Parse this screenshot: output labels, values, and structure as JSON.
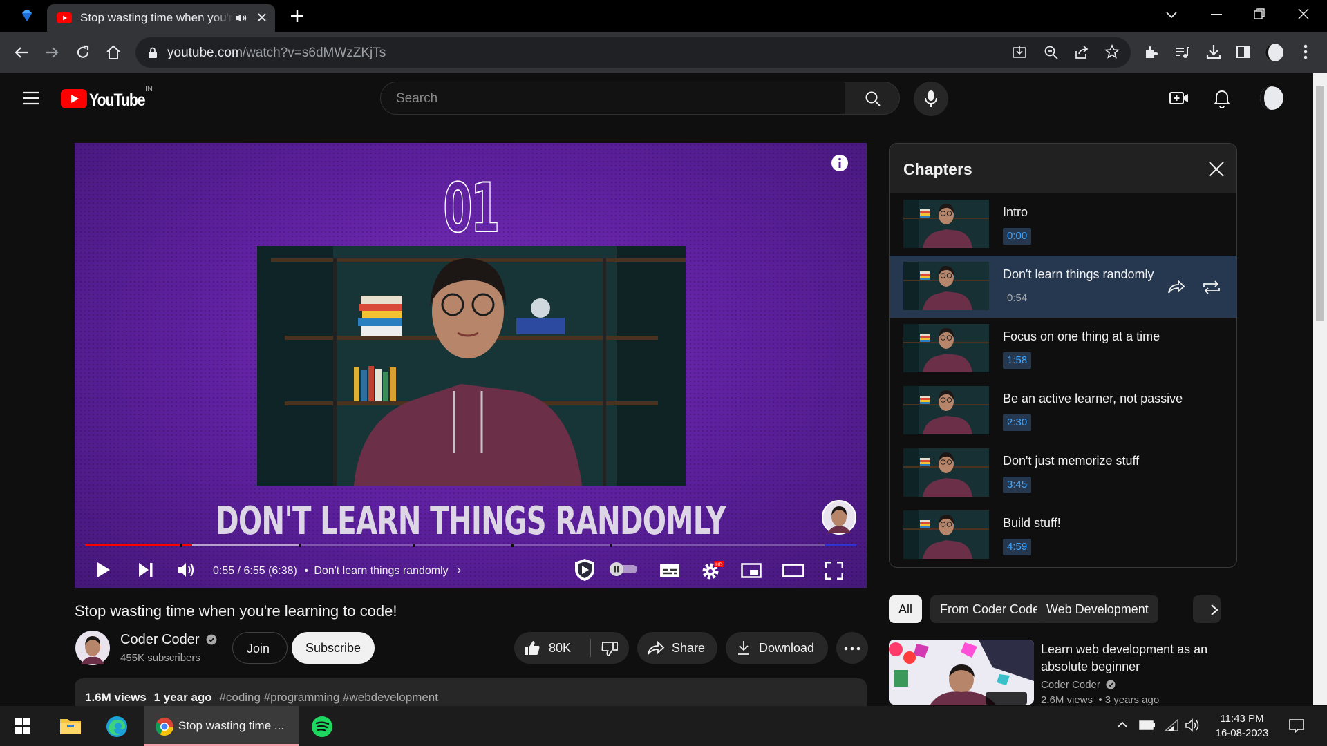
{
  "browser": {
    "tab_title": "Stop wasting time when you're learning to code!",
    "url_host": "youtube.com",
    "url_path": "/watch?v=s6dMWzZKjTs"
  },
  "yt": {
    "logo_text": "YouTube",
    "region": "IN",
    "search_placeholder": "Search"
  },
  "player": {
    "chapter_number": "01",
    "overlay_title": "DON'T LEARN THINGS RANDOMLY",
    "time_text": "0:55 / 6:55 (6:38)",
    "chapter_label": "Don't learn things randomly",
    "progress_fraction": 0.139
  },
  "chapters": {
    "title": "Chapters",
    "items": [
      {
        "title": "Intro",
        "time": "0:00"
      },
      {
        "title": "Don't learn things randomly",
        "time": "0:54"
      },
      {
        "title": "Focus on one thing at a time",
        "time": "1:58"
      },
      {
        "title": "Be an active learner, not passive",
        "time": "2:30"
      },
      {
        "title": "Don't just memorize stuff",
        "time": "3:45"
      },
      {
        "title": "Build stuff!",
        "time": "4:59"
      }
    ]
  },
  "chips": [
    "All",
    "From Coder Coder",
    "Web Development"
  ],
  "related": {
    "title_line1": "Learn web development as an",
    "title_line2": "absolute beginner",
    "channel": "Coder Coder",
    "meta": "2.6M views  • 3 years ago"
  },
  "video": {
    "title": "Stop wasting time when you're learning to code!",
    "channel": "Coder Coder",
    "subscribers": "455K subscribers",
    "join_label": "Join",
    "subscribe_label": "Subscribe",
    "likes": "80K",
    "share_label": "Share",
    "download_label": "Download",
    "views": "1.6M views",
    "age": "1 year ago",
    "hashtags": "#coding #programming #webdevelopment"
  },
  "taskbar": {
    "chrome_label": "Stop wasting time ...",
    "time": "11:43 PM",
    "date": "16-08-2023"
  },
  "colors": {
    "youtube_red": "#ff0000",
    "link_blue": "#3ea6ff",
    "active_chapter_bg": "#263850"
  }
}
